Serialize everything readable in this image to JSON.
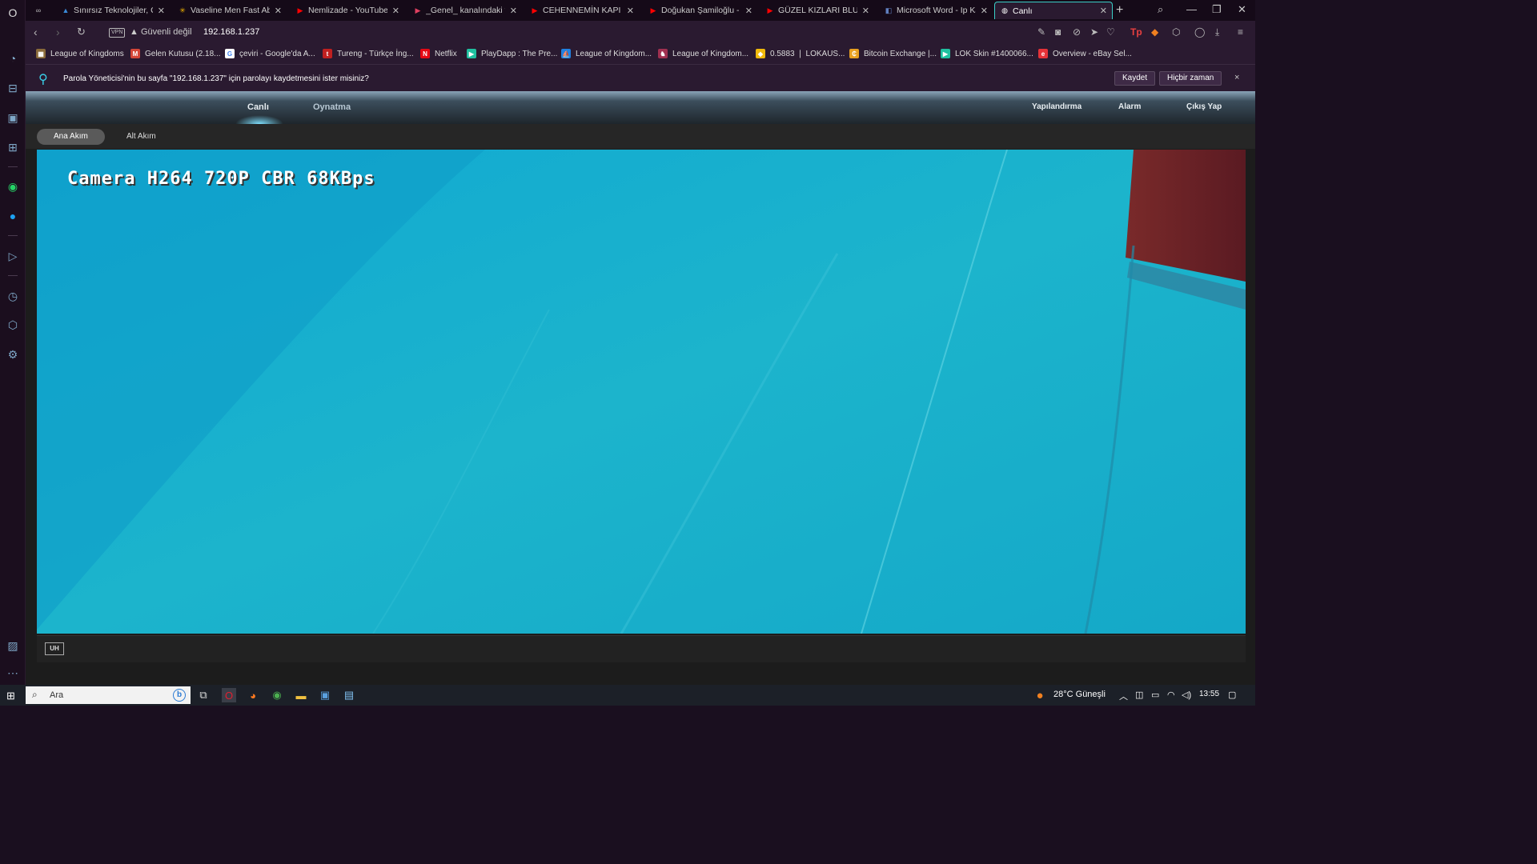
{
  "browser": {
    "tabs": [
      {
        "title": "Sınırsız Teknolojiler, Gü",
        "icon": "arc-icon",
        "color": "#3a8ad8"
      },
      {
        "title": "Vaseline Men Fast Abso",
        "icon": "walmart-icon",
        "color": "#f5b800"
      },
      {
        "title": "Nemlizade - YouTube",
        "icon": "youtube-icon",
        "color": "#ff0000"
      },
      {
        "title": "_Genel_ kanalındaki top",
        "icon": "play-icon",
        "color": "#e04060"
      },
      {
        "title": "CEHENNEMİN KAPI",
        "icon": "youtube-icon",
        "color": "#ff0000"
      },
      {
        "title": "Doğukan Şamiloğlu - Yo",
        "icon": "youtube-icon",
        "color": "#ff0000"
      },
      {
        "title": "GÜZEL KIZLARI BLUETO",
        "icon": "youtube-icon",
        "color": "#ff0000"
      },
      {
        "title": "Microsoft Word - Ip Kar",
        "icon": "doc-icon",
        "color": "#6080c0"
      },
      {
        "title": "Canlı",
        "icon": "globe-icon",
        "color": "#ffffff"
      }
    ],
    "address": {
      "vpn": "VPN",
      "security": "Güvenli değil",
      "url": "192.168.1.237"
    },
    "bookmarks": [
      {
        "label": "League of Kingdoms",
        "icon": "lok-icon",
        "color": "#8a6a3a"
      },
      {
        "label": "Gelen Kutusu (2.18...",
        "icon": "gmail-icon",
        "color": "#d44638"
      },
      {
        "label": "çeviri - Google'da A...",
        "icon": "google-icon",
        "color": "#ffffff"
      },
      {
        "label": "Tureng - Türkçe İng...",
        "icon": "tureng-icon",
        "color": "#c02020"
      },
      {
        "label": "Netflix",
        "icon": "netflix-icon",
        "color": "#e50914"
      },
      {
        "label": "PlayDapp : The Pre...",
        "icon": "playdapp-icon",
        "color": "#20c0a0"
      },
      {
        "label": "League of Kingdom...",
        "icon": "opensea-icon",
        "color": "#2081e2"
      },
      {
        "label": "League of Kingdom...",
        "icon": "lok2-icon",
        "color": "#a03050"
      },
      {
        "label": "0.5883 ❘ LOKAUS...",
        "icon": "binance-icon",
        "color": "#f0b90b"
      },
      {
        "label": "Bitcoin Exchange |...",
        "icon": "coin-icon",
        "color": "#e8a020"
      },
      {
        "label": "LOK Skin #1400066...",
        "icon": "playdapp-icon",
        "color": "#20c0a0"
      },
      {
        "label": "Overview - eBay Sel...",
        "icon": "ebay-icon",
        "color": "#e53238"
      }
    ],
    "password_bar": {
      "message": "Parola Yöneticisi'nin bu sayfa \"192.168.1.237\" için parolayı kaydetmesini ister misiniz?",
      "save": "Kaydet",
      "never": "Hiçbir zaman",
      "close": "×"
    }
  },
  "camera": {
    "nav": {
      "live": "Canlı",
      "playback": "Oynatma",
      "config": "Yapılandırma",
      "alarm": "Alarm",
      "logout": "Çıkış Yap"
    },
    "streams": {
      "main": "Ana Akım",
      "sub": "Alt Akım"
    },
    "osd": "Camera H264 720P CBR 68KBps",
    "hbtn": "UH"
  },
  "taskbar": {
    "search_placeholder": "Ara",
    "weather": "28°C  Güneşli",
    "time": "13:55"
  }
}
